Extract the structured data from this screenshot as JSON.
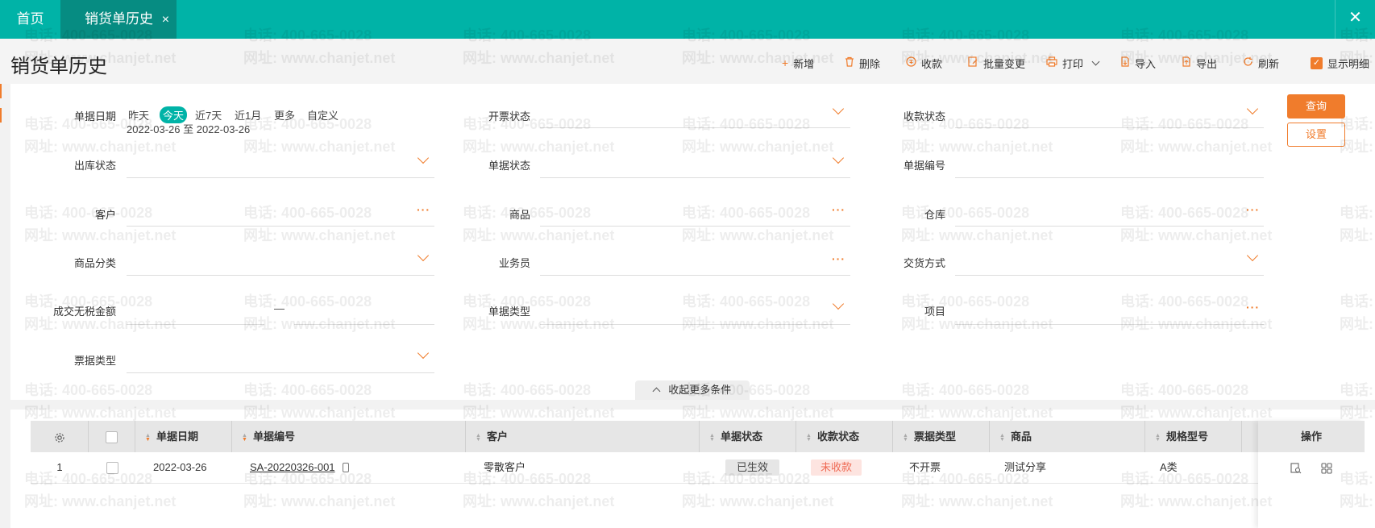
{
  "tabs": {
    "home": "首页",
    "active": "销货单历史",
    "active_close": "×",
    "close_all": "✕"
  },
  "page": {
    "title": "销货单历史"
  },
  "toolbar": {
    "add": "新增",
    "delete": "删除",
    "receive": "收款",
    "batch_change": "批量变更",
    "print": "打印",
    "import": "导入",
    "export": "导出",
    "refresh": "刷新",
    "show_detail": "显示明细"
  },
  "filters": {
    "doc_date_label": "单据日期",
    "date_options": [
      "昨天",
      "今天",
      "近7天",
      "近1月",
      "更多",
      "自定义"
    ],
    "date_range": "2022-03-26 至 2022-03-26",
    "invoice_status": "开票状态",
    "payment_status": "收款状态",
    "outbound_status": "出库状态",
    "doc_status": "单据状态",
    "doc_number": "单据编号",
    "customer": "客户",
    "product": "商品",
    "warehouse": "仓库",
    "product_category": "商品分类",
    "salesperson": "业务员",
    "delivery_method": "交货方式",
    "amount_ex_tax": "成交无税金额",
    "range_sep": "—",
    "doc_type": "单据类型",
    "project": "项目",
    "ticket_type": "票据类型",
    "query_button": "查询",
    "settings_button": "设置",
    "collapse": "收起更多条件"
  },
  "table": {
    "headers": [
      "单据日期",
      "单据编号",
      "客户",
      "单据状态",
      "收款状态",
      "票据类型",
      "商品",
      "规格型号"
    ],
    "ops_header": "操作",
    "rows": [
      {
        "index": "1",
        "date": "2022-03-26",
        "number": "SA-20220326-001",
        "customer": "零散客户",
        "doc_status": "已生效",
        "pay_status": "未收款",
        "ticket_type": "不开票",
        "product": "测试分享",
        "spec": "A类"
      }
    ]
  },
  "watermark": {
    "phone": "电话: 400-665-0028",
    "site": "网址: www.chanjet.net"
  },
  "colors": {
    "brand_teal": "#00b3a7",
    "active_tab": "#068c82",
    "accent_orange": "#f07c2c"
  }
}
